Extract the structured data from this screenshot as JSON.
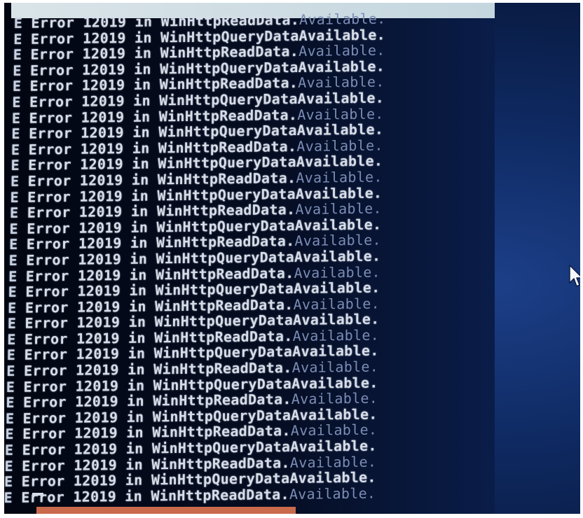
{
  "console": {
    "lines": [
      "E Error 12019 in WinHttpReadData.",
      "E Error 12019 in WinHttpQueryDataAvailable.",
      "E Error 12019 in WinHttpReadData.",
      "E Error 12019 in WinHttpQueryDataAvailable.",
      "E Error 12019 in WinHttpReadData.",
      "E Error 12019 in WinHttpQueryDataAvailable.",
      "E Error 12019 in WinHttpReadData.",
      "E Error 12019 in WinHttpQueryDataAvailable.",
      "E Error 12019 in WinHttpReadData.",
      "E Error 12019 in WinHttpQueryDataAvailable.",
      "E Error 12019 in WinHttpReadData.",
      "E Error 12019 in WinHttpQueryDataAvailable.",
      "E Error 12019 in WinHttpReadData.",
      "E Error 12019 in WinHttpQueryDataAvailable.",
      "E Error 12019 in WinHttpReadData.",
      "E Error 12019 in WinHttpQueryDataAvailable.",
      "E Error 12019 in WinHttpReadData.",
      "E Error 12019 in WinHttpQueryDataAvailable.",
      "E Error 12019 in WinHttpReadData.",
      "E Error 12019 in WinHttpQueryDataAvailable.",
      "E Error 12019 in WinHttpReadData.",
      "E Error 12019 in WinHttpQueryDataAvailable.",
      "E Error 12019 in WinHttpReadData.",
      "E Error 12019 in WinHttpQueryDataAvailable.",
      "E Error 12019 in WinHttpReadData.",
      "E Error 12019 in WinHttpQueryDataAvailable.",
      "E Error 12019 in WinHttpReadData.",
      "E Error 12019 in WinHttpQueryDataAvailable.",
      "E Error 12019 in WinHttpReadData.",
      "E Error 12019 in WinHttpQueryDataAvailable.",
      "E Error 12019 in WinHttpReadData."
    ],
    "ghost_tail": "Available.",
    "cursor_icon": "text-cursor-icon"
  },
  "colors": {
    "console_bg": "#040a1c",
    "text": "#d7dde7",
    "desktop_bg": "#123478",
    "title_bar": "#d2dfe5",
    "taskbar_accent": "#c96a4c"
  },
  "icons": {
    "pointer": "mouse-pointer-icon"
  }
}
